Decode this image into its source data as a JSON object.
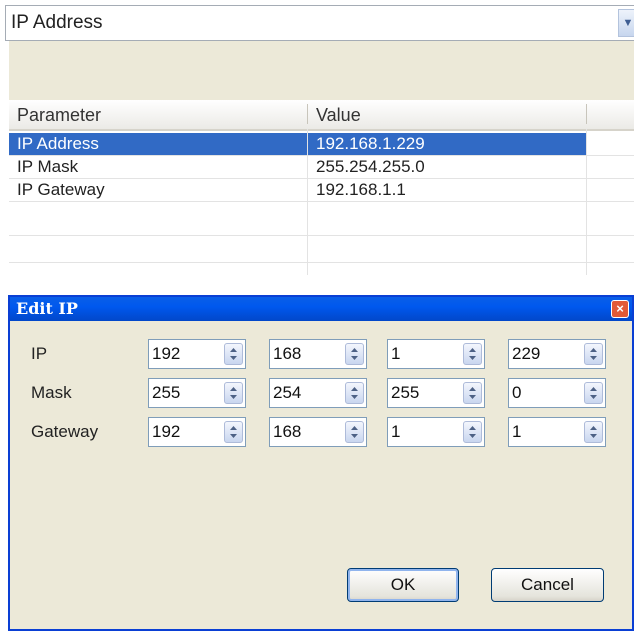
{
  "selector": {
    "value": "IP Address"
  },
  "table": {
    "headers": [
      "Parameter",
      "Value"
    ],
    "rows": [
      {
        "param": "IP Address",
        "value": "192.168.1.229",
        "selected": true
      },
      {
        "param": "IP Mask",
        "value": "255.254.255.0",
        "selected": false
      },
      {
        "param": "IP Gateway",
        "value": "192.168.1.1",
        "selected": false
      },
      {
        "param": "",
        "value": "",
        "selected": false
      },
      {
        "param": "",
        "value": "",
        "selected": false
      }
    ]
  },
  "dialog": {
    "title": "Edit IP",
    "rows": [
      {
        "label": "IP",
        "octets": [
          "192",
          "168",
          "1",
          "229"
        ]
      },
      {
        "label": "Mask",
        "octets": [
          "255",
          "254",
          "255",
          "0"
        ]
      },
      {
        "label": "Gateway",
        "octets": [
          "192",
          "168",
          "1",
          "1"
        ]
      }
    ],
    "ok_label": "OK",
    "cancel_label": "Cancel"
  },
  "colors": {
    "selection": "#316ac5",
    "titlebar": "#0058ee",
    "dialog_bg": "#ece9d8",
    "close": "#e35a37"
  }
}
